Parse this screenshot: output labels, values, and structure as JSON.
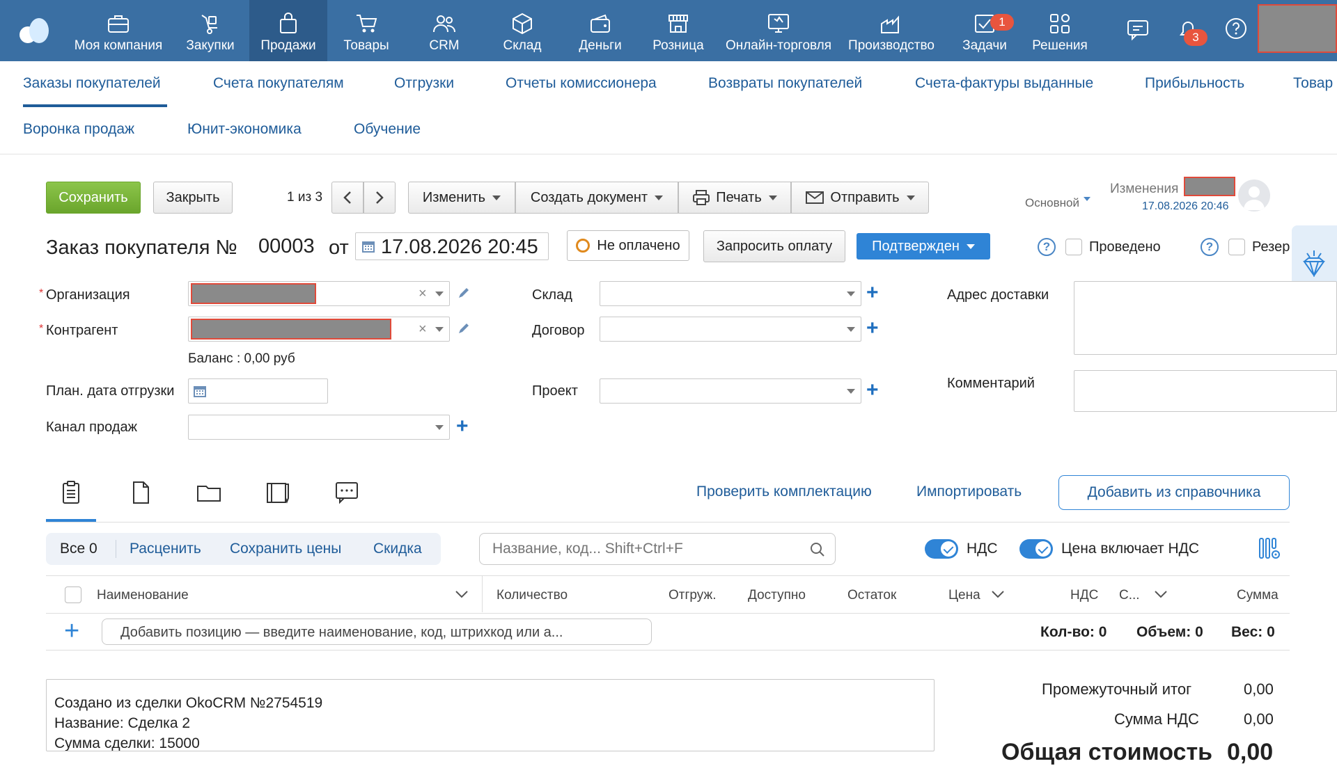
{
  "topnav": {
    "items": [
      {
        "label": "Моя компания",
        "icon": "briefcase-icon"
      },
      {
        "label": "Закупки",
        "icon": "cart-carry-icon"
      },
      {
        "label": "Продажи",
        "icon": "shopping-bag-icon",
        "active": true
      },
      {
        "label": "Товары",
        "icon": "cart-icon"
      },
      {
        "label": "CRM",
        "icon": "users-icon"
      },
      {
        "label": "Склад",
        "icon": "box-icon"
      },
      {
        "label": "Деньги",
        "icon": "wallet-icon"
      },
      {
        "label": "Розница",
        "icon": "store-icon"
      },
      {
        "label": "Онлайн-торговля",
        "icon": "online-shop-icon"
      },
      {
        "label": "Производство",
        "icon": "factory-icon"
      },
      {
        "label": "Задачи",
        "icon": "tasks-icon",
        "badge": "1"
      },
      {
        "label": "Решения",
        "icon": "apps-icon"
      }
    ],
    "notifications_badge": "3"
  },
  "subnav": {
    "row1": [
      "Заказы покупателей",
      "Счета покупателям",
      "Отгрузки",
      "Отчеты комиссионера",
      "Возвраты покупателей",
      "Счета-фактуры выданные",
      "Прибыльность",
      "Товар"
    ],
    "row2": [
      "Воронка продаж",
      "Юнит-экономика",
      "Обучение"
    ]
  },
  "toolbar": {
    "save": "Сохранить",
    "close": "Закрыть",
    "pager": "1 из 3",
    "edit": "Изменить",
    "create_doc": "Создать документ",
    "print": "Печать",
    "send": "Отправить",
    "view": "Основной",
    "changes_label": "Изменения",
    "changes_date": "17.08.2026 20:46"
  },
  "header": {
    "title": "Заказ покупателя №",
    "number": "00003",
    "from": "от",
    "date": "17.08.2026 20:45",
    "payment_status": "Не оплачено",
    "request_payment": "Запросить оплату",
    "status": "Подтвержден",
    "posted": "Проведено",
    "reserve": "Резер"
  },
  "form": {
    "org_label": "Организация",
    "contractor_label": "Контрагент",
    "balance": "Баланс : 0,00 руб",
    "ship_date_label": "План. дата отгрузки",
    "channel_label": "Канал продаж",
    "warehouse_label": "Склад",
    "contract_label": "Договор",
    "project_label": "Проект",
    "address_label": "Адрес доставки",
    "comment_label": "Комментарий"
  },
  "positions": {
    "check_kit": "Проверить комплектацию",
    "import": "Импортировать",
    "add_from_catalog": "Добавить из справочника",
    "all": "Все 0",
    "reprice": "Расценить",
    "save_prices": "Сохранить цены",
    "discount": "Скидка",
    "search_placeholder": "Название, код... Shift+Ctrl+F",
    "vat": "НДС",
    "price_incl_vat": "Цена включает НДС",
    "columns": {
      "name": "Наименование",
      "qty": "Количество",
      "shipped": "Отгруж.",
      "available": "Доступно",
      "stock": "Остаток",
      "price": "Цена",
      "vat": "НДС",
      "c": "С...",
      "sum": "Сумма"
    },
    "add_placeholder": "Добавить позицию — введите наименование, код, штрихкод или а...",
    "count": "Кол-во: 0",
    "volume": "Объем: 0",
    "weight": "Вес: 0"
  },
  "comment": {
    "line1": "Создано из сделки OkoCRM №2754519",
    "line2": "Название: Сделка 2",
    "line3": "Сумма сделки: 15000"
  },
  "totals": {
    "subtotal_label": "Промежуточный итог",
    "subtotal": "0,00",
    "vat_label": "Сумма НДС",
    "vat": "0,00",
    "total_label": "Общая стоимость",
    "total": "0,00"
  }
}
